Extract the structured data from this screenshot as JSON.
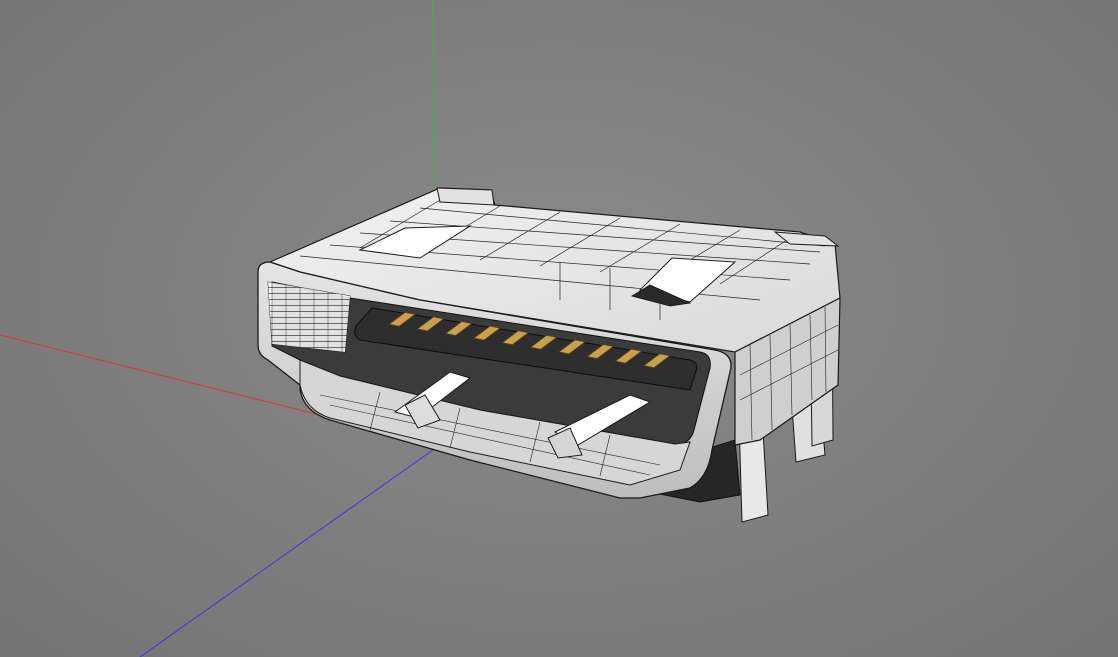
{
  "viewport": {
    "background": "#808080",
    "axes": {
      "x_axis_color": "#d23a3a",
      "y_axis_color": "#2fbf2f",
      "z_axis_color": "#3a3ad2"
    }
  },
  "model": {
    "shell_color": "#e9e9e9",
    "edge_color": "#1a1a1a",
    "insulator_color": "#2b2b2b",
    "contact_color": "#c9a050",
    "contact_count": 10
  }
}
